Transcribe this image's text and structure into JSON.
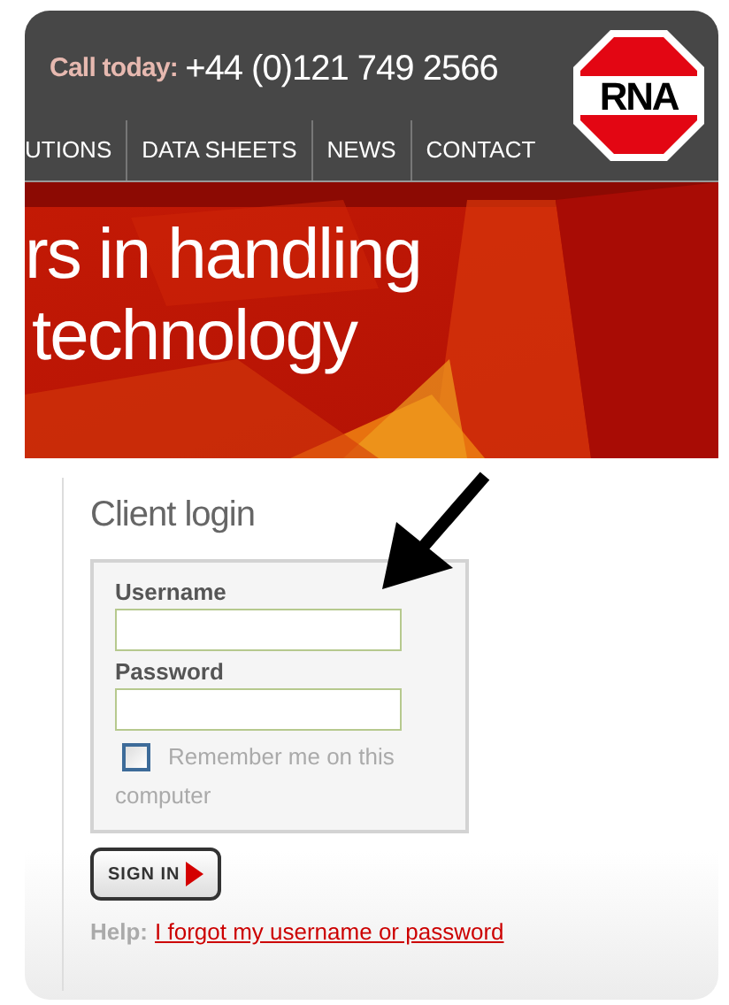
{
  "header": {
    "call_label": "Call today:",
    "phone": "+44 (0)121 749 2566",
    "logo_text": "RNA"
  },
  "nav": [
    {
      "label": "UTIONS"
    },
    {
      "label": "DATA SHEETS"
    },
    {
      "label": "NEWS"
    },
    {
      "label": "CONTACT"
    }
  ],
  "banner": {
    "lines": [
      "rs in handling",
      "technology"
    ]
  },
  "login": {
    "title": "Client login",
    "fields": [
      {
        "label": "Username"
      },
      {
        "label": "Password"
      }
    ],
    "remember": {
      "label": "Remember me on this computer",
      "checked": false
    },
    "button": "SIGN IN",
    "help_label": "Help:",
    "help_link": "I forgot my username or password"
  }
}
